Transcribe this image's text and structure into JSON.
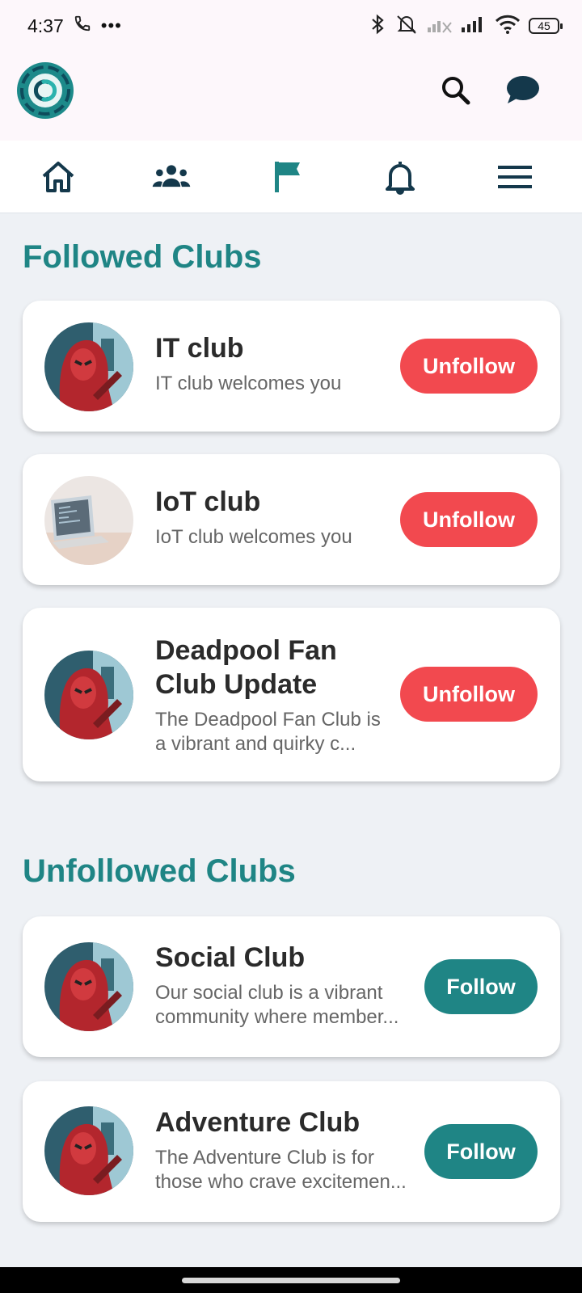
{
  "status_bar": {
    "time": "4:37",
    "battery": "45"
  },
  "nav": {
    "items": [
      {
        "icon": "home-icon",
        "active": false
      },
      {
        "icon": "people-icon",
        "active": false
      },
      {
        "icon": "flag-icon",
        "active": true
      },
      {
        "icon": "bell-icon",
        "active": false
      },
      {
        "icon": "menu-icon",
        "active": false
      }
    ],
    "active_color": "#1f8585",
    "inactive_color": "#14384b"
  },
  "header": {
    "logo": "app-logo-icon",
    "icons": [
      "search-icon",
      "chat-icon"
    ]
  },
  "followed": {
    "title": "Followed Clubs",
    "clubs": [
      {
        "name": "IT club",
        "desc": "IT club welcomes you",
        "button": "Unfollow"
      },
      {
        "name": "IoT club",
        "desc": "IoT club welcomes you",
        "button": "Unfollow"
      },
      {
        "name": "Deadpool Fan Club Update",
        "desc": "The Deadpool Fan Club is a vibrant and quirky c...",
        "button": "Unfollow"
      }
    ]
  },
  "unfollowed": {
    "title": "Unfollowed Clubs",
    "clubs": [
      {
        "name": "Social Club",
        "desc": "Our social club is a vibrant community where member...",
        "button": "Follow"
      },
      {
        "name": "Adventure Club",
        "desc": "The Adventure Club is for those who crave excitemen...",
        "button": "Follow"
      }
    ]
  },
  "colors": {
    "accent": "#1f8585",
    "unfollow": "#f2494f",
    "follow": "#1f8585"
  }
}
